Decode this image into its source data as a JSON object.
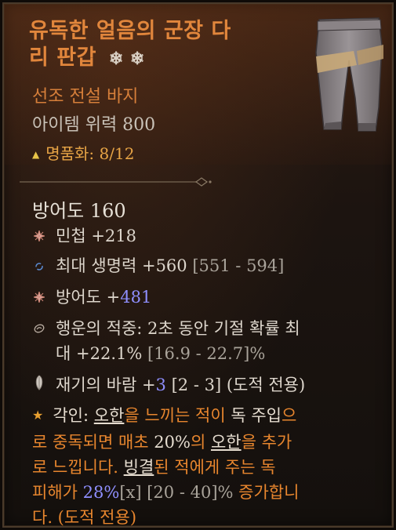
{
  "item": {
    "title_line1": "유독한 얼음의 군장 다",
    "title_line2": "리 판갑",
    "title_prefix_symbol": "❄",
    "title_symbols": "❄ ❄",
    "subtitle": "선조 전설 바지",
    "item_power": "아이템 위력 800",
    "masterwork": "명품화: 8/12"
  },
  "stats": {
    "armor": "방어도 160",
    "dex": {
      "label": "민첩",
      "value": "+218"
    },
    "life": {
      "label": "최대 생명력",
      "value": "+560",
      "range": "[551 - 594]"
    },
    "armor_bonus": {
      "label": "방어도 +",
      "value": "481"
    },
    "luck_line1": "행운의 적중: 2초 동안 기절 확률 최",
    "luck_line2_pre": "대 +22.1%",
    "luck_range": "[16.9 - 22.7]%",
    "wind": {
      "label": "재기의 바람 +",
      "value": "3",
      "range": "[2 - 3] (도적 전용)"
    }
  },
  "aspect": {
    "label": "각인:",
    "p1": "오한",
    "p2": "을 느끼는 적이 ",
    "p3": "독 주입",
    "p4": "으",
    "p5": "로 중독되면 매초 ",
    "p6": "20%",
    "p7": "의 ",
    "p8": "오한",
    "p9": "을 추가",
    "p10": "로 느낍니다. ",
    "p11": "빙결",
    "p12": "된 적에게 주는 독",
    "p13": "피해가 ",
    "p14": "28%",
    "p15": "[x] [20 - 40]%",
    "p16": " 증가합니",
    "p17": "다. (도적 전용)"
  },
  "icons": {
    "masterwork": "triangle-icon",
    "dex": "star-burst-icon",
    "life": "swirl-icon",
    "armor": "star-burst-icon",
    "luck": "swirl-circle-icon",
    "wind": "feather-icon",
    "aspect": "star-icon"
  },
  "colors": {
    "legendary": "#e1863c",
    "blue_value": "#8f8fff",
    "aspect_text": "#e8862e"
  }
}
